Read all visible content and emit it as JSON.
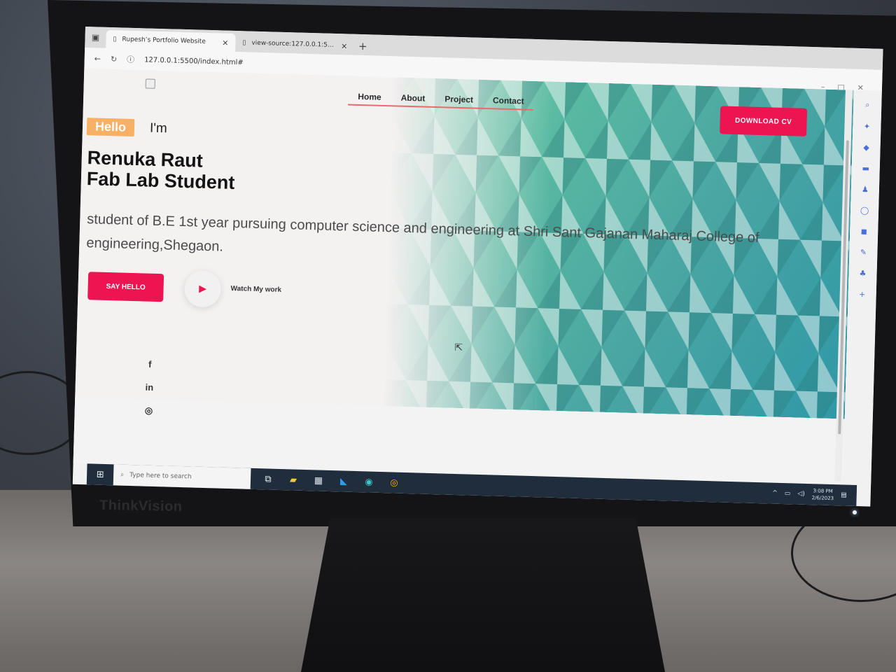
{
  "browser": {
    "tabs": [
      {
        "title": "Rupesh’s Portfolio Website",
        "close": "×"
      },
      {
        "title": "view-source:127.0.0.1:5500/inde…",
        "close": "×"
      }
    ],
    "new_tab": "+",
    "url": "127.0.0.1:5500/index.html#"
  },
  "page": {
    "nav": [
      "Home",
      "About",
      "Project",
      "Contact"
    ],
    "download_cv": "DOWNLOAD CV",
    "hello": "Hello",
    "im": "I'm",
    "name_line1": "Renuka Raut",
    "name_line2": "Fab Lab Student",
    "description": "student of B.E 1st year pursuing computer science and engineering at Shri Sant Gajanan Maharaj College of engineering,Shegaon.",
    "say_hello": "SAY HELLO",
    "watch": "Watch My work",
    "social": [
      "f",
      "in",
      "◎"
    ]
  },
  "taskbar": {
    "search_placeholder": "Type here to search",
    "time": "3:08 PM",
    "date": "2/6/2023"
  },
  "monitor": {
    "brand": "ThinkVision"
  },
  "colors": {
    "accent": "#ec1552",
    "hello_badge": "#f7b064",
    "taskbar": "#1f2d3c"
  }
}
